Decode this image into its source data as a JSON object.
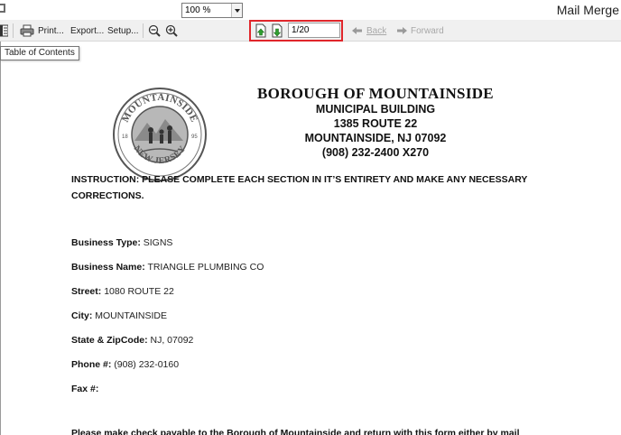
{
  "window": {
    "title": "Mail Merge"
  },
  "toolbar": {
    "print_label": "Print...",
    "export_label": "Export...",
    "setup_label": "Setup...",
    "zoom_value": "100 %",
    "page_value": "1/20",
    "back_label": "Back",
    "forward_label": "Forward"
  },
  "tooltip": {
    "text": "Table of Contents"
  },
  "document": {
    "header": {
      "line1": "BOROUGH OF MOUNTAINSIDE",
      "line2": "MUNICIPAL BUILDING",
      "line3": "1385 ROUTE 22",
      "line4": "MOUNTAINSIDE, NJ 07092",
      "line5": "(908) 232-2400 X270"
    },
    "seal": {
      "top_text": "MOUNTAINSIDE",
      "bottom_text": "NEW JERSEY",
      "year_left": "18",
      "year_right": "95"
    },
    "instruction": "INSTRUCTION: PLEASE COMPLETE EACH SECTION IN IT’S ENTIRETY AND MAKE ANY NECESSARY CORRECTIONS.",
    "fields": [
      {
        "label": "Business Type:",
        "value": "SIGNS"
      },
      {
        "label": "Business Name:",
        "value": "TRIANGLE PLUMBING CO"
      },
      {
        "label": "Street:",
        "value": "1080 ROUTE 22"
      },
      {
        "label": "City:",
        "value": "MOUNTAINSIDE"
      },
      {
        "label": "State & ZipCode:",
        "value": "NJ, 07092"
      },
      {
        "label": "Phone #:",
        "value": "(908) 232-0160"
      },
      {
        "label": "Fax #:",
        "value": ""
      }
    ],
    "trailing_text": "Please make check payable to the Borough of Mountainside and return with this form either by mail"
  },
  "colors": {
    "highlight": "#e0262b",
    "toolbar_bg": "#f0f0f0",
    "arrow_green": "#2f9e2f"
  }
}
